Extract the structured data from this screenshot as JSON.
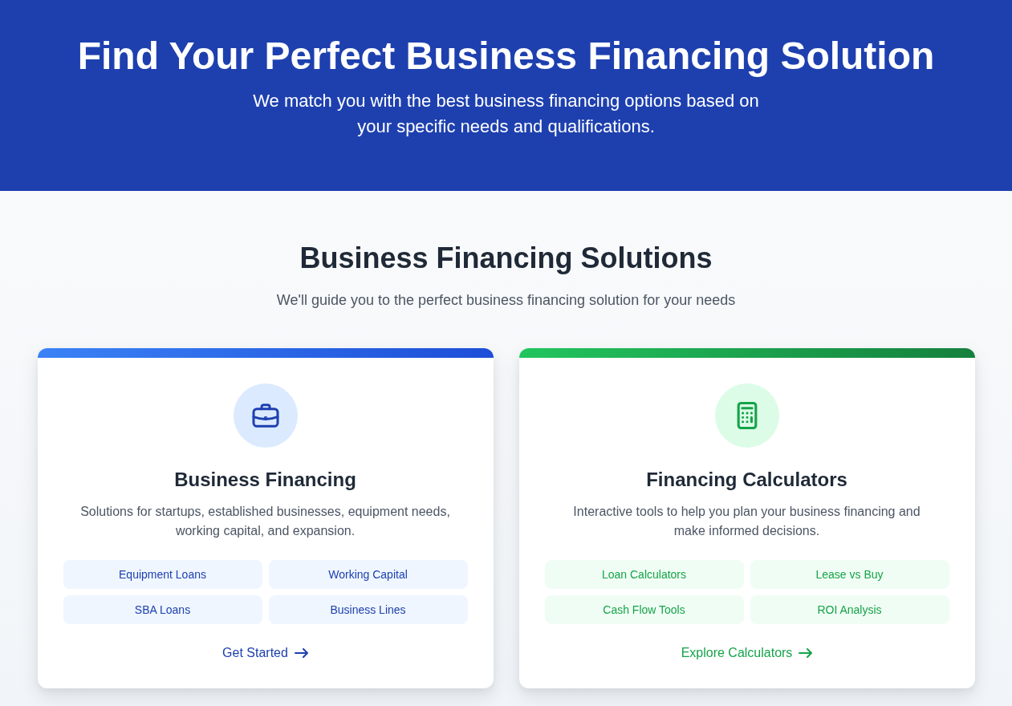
{
  "hero": {
    "title": "Find Your Perfect Business Financing Solution",
    "subtitle": "We match you with the best business financing options based on your specific needs and qualifications."
  },
  "section": {
    "title": "Business Financing Solutions",
    "subtitle": "We'll guide you to the perfect business financing solution for your needs"
  },
  "cards": [
    {
      "kind": "financing",
      "color": "#1e40af",
      "title": "Business Financing",
      "description": "Solutions for startups, established businesses, equipment needs, working capital, and expansion.",
      "tags": [
        "Equipment Loans",
        "Working Capital",
        "SBA Loans",
        "Business Lines"
      ],
      "link": "Get Started"
    },
    {
      "kind": "calculators",
      "color": "#16a34a",
      "title": "Financing Calculators",
      "description": "Interactive tools to help you plan your business financing and make informed decisions.",
      "tags": [
        "Loan Calculators",
        "Lease vs Buy",
        "Cash Flow Tools",
        "ROI Analysis"
      ],
      "link": "Explore Calculators"
    }
  ]
}
